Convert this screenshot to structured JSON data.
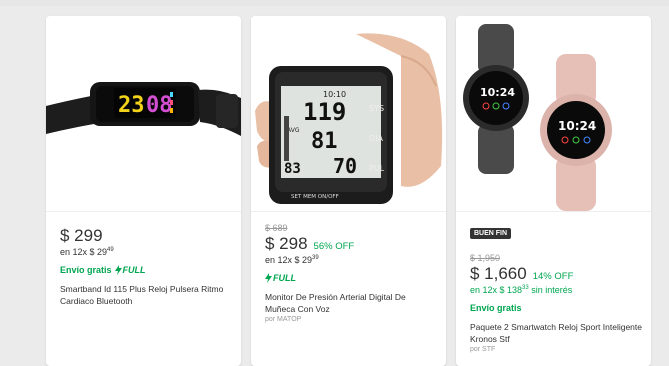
{
  "products": [
    {
      "price": "$ 299",
      "installments": "en 12x $ 29",
      "installments_cents": "49",
      "shipping": "Envío gratis",
      "full": "FULL",
      "title": "Smartband Id 115 Plus Reloj Pulsera Ritmo Cardiaco Bluetooth",
      "band_display": "23 08"
    },
    {
      "original_price": "$ 689",
      "price": "$ 298",
      "discount": "56% OFF",
      "installments": "en 12x $ 29",
      "installments_cents": "39",
      "full": "FULL",
      "title": "Monitor De Presión Arterial Digital De Muñeca Con Voz",
      "seller": "por MATOP",
      "monitor": {
        "sys": "119",
        "dia": "81",
        "pul": "70",
        "pulse_prefix": "83",
        "clock": "10:10",
        "sys_label": "SYS",
        "dia_label": "DIA",
        "pul_label": "PUL",
        "avg_label": "AVG",
        "buttons": "SET  MEM  ON/OFF"
      }
    },
    {
      "badge": "BUEN FIN",
      "original_price": "$ 1,950",
      "price": "$ 1,660",
      "discount": "14% OFF",
      "installments": "en 12x $ 138",
      "installments_cents": "33",
      "installments_suffix": " sin interés",
      "shipping": "Envío gratis",
      "title": "Paquete 2 Smartwatch Reloj Sport Inteligente Kronos Stf",
      "seller": "por STF",
      "watch_time": "10:24"
    }
  ],
  "colors": {
    "accent_green": "#00a650",
    "text": "#333333",
    "muted": "#999999"
  }
}
